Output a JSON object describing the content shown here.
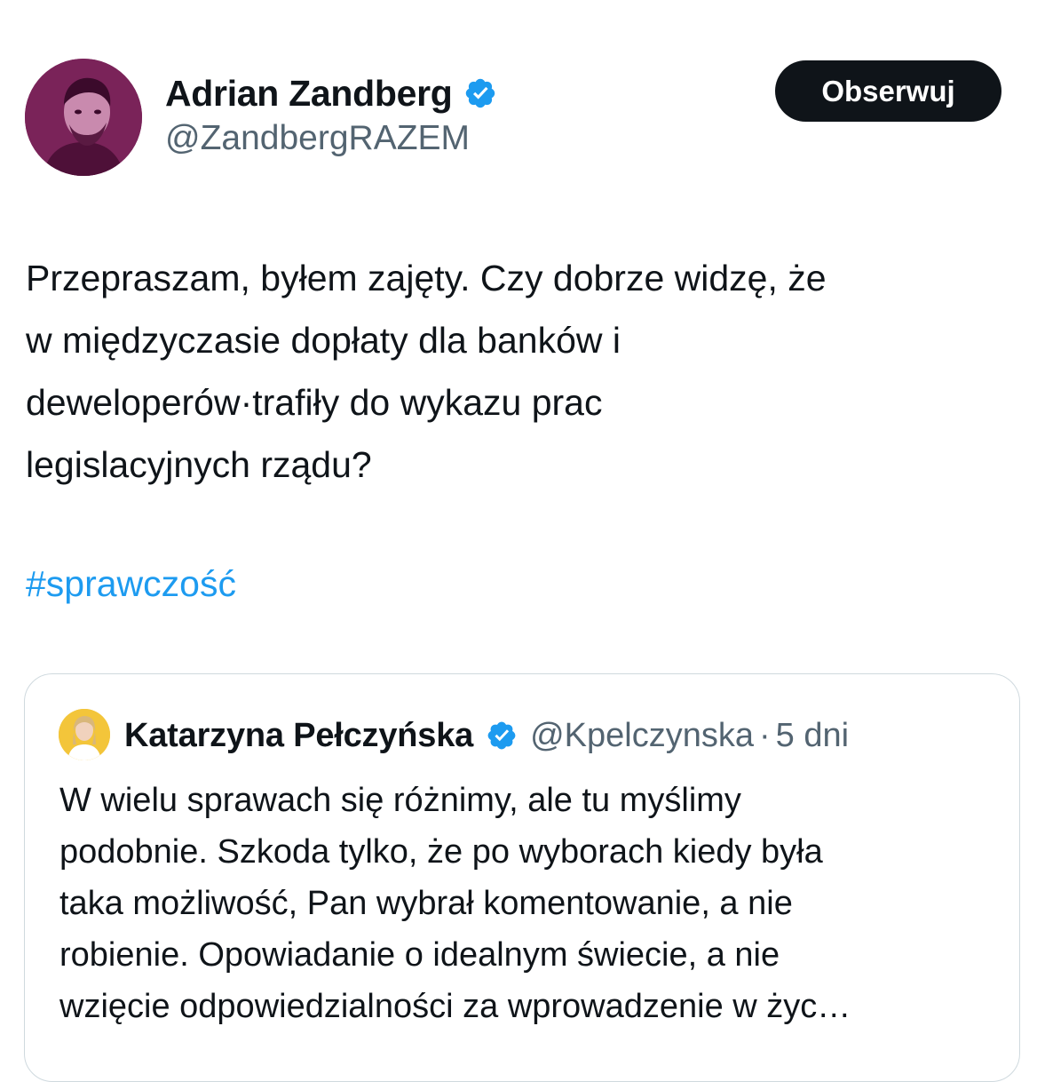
{
  "author": {
    "display_name": "Adrian Zandberg",
    "handle": "@ZandbergRAZEM",
    "verified_icon": "verified-badge-icon",
    "avatar_color": "#8a2f66"
  },
  "follow_button": {
    "label": "Obserwuj"
  },
  "tweet": {
    "lines": [
      "Przepraszam, byłem zajęty. Czy dobrze widzę, że",
      "w międzyczasie dopłaty dla banków i",
      "deweloperów·trafiły do wykazu prac",
      "legislacyjnych rządu?"
    ],
    "hashtag": "#sprawczość"
  },
  "quoted_tweet": {
    "display_name": "Katarzyna Pełczyńska",
    "handle": "@Kpelczynska",
    "separator": "·",
    "time": "5 dni",
    "lines": [
      "W wielu sprawach się różnimy, ale tu myślimy",
      "podobnie. Szkoda tylko, że po wyborach kiedy była",
      "taka możliwość, Pan wybrał komentowanie, a nie",
      "robienie. Opowiadanie o idealnym świecie, a nie",
      "wzięcie odpowiedzialności za wprowadzenie w życ…"
    ],
    "avatar_color": "#f3c53a"
  },
  "colors": {
    "text": "#0f1419",
    "secondary": "#536471",
    "link": "#1d9bf0",
    "verified": "#1d9bf0",
    "border": "#cfd9de"
  }
}
